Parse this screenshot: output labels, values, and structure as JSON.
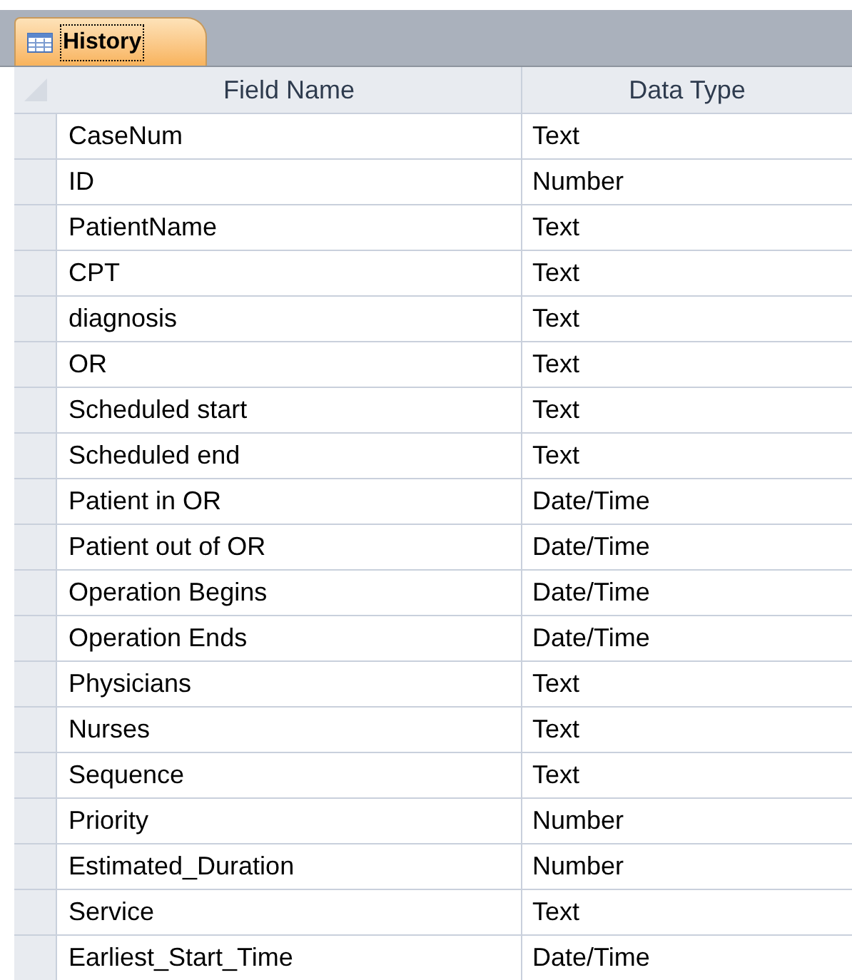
{
  "tabs": [
    {
      "label": "History",
      "selected": true
    }
  ],
  "table": {
    "columns": [
      "Field Name",
      "Data Type"
    ],
    "rows": [
      {
        "cells": [
          "CaseNum",
          "Text"
        ]
      },
      {
        "cells": [
          "ID",
          "Number"
        ]
      },
      {
        "cells": [
          "PatientName",
          "Text"
        ]
      },
      {
        "cells": [
          "CPT",
          "Text"
        ]
      },
      {
        "cells": [
          "diagnosis",
          "Text"
        ]
      },
      {
        "cells": [
          "OR",
          "Text"
        ]
      },
      {
        "cells": [
          "Scheduled start",
          "Text"
        ]
      },
      {
        "cells": [
          "Scheduled end",
          "Text"
        ]
      },
      {
        "cells": [
          "Patient in OR",
          "Date/Time"
        ]
      },
      {
        "cells": [
          "Patient out of OR",
          "Date/Time"
        ]
      },
      {
        "cells": [
          "Operation Begins",
          "Date/Time"
        ]
      },
      {
        "cells": [
          "Operation Ends",
          "Date/Time"
        ]
      },
      {
        "cells": [
          "Physicians",
          "Text"
        ]
      },
      {
        "cells": [
          "Nurses",
          "Text"
        ]
      },
      {
        "cells": [
          "Sequence",
          "Text"
        ]
      },
      {
        "cells": [
          "Priority",
          "Number"
        ]
      },
      {
        "cells": [
          "Estimated_Duration",
          "Number"
        ]
      },
      {
        "cells": [
          "Service",
          "Text"
        ]
      },
      {
        "cells": [
          "Earliest_Start_Time",
          "Date/Time"
        ]
      }
    ]
  }
}
